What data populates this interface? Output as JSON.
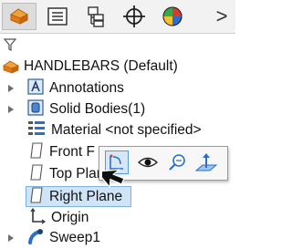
{
  "colors": {
    "accent_blue": "#3a7fc4",
    "selection_bg": "#cfe5f7",
    "orange": "#e07b1a"
  },
  "tabs": [
    {
      "icon": "feature-manager-icon",
      "active": true
    },
    {
      "icon": "property-manager-icon",
      "active": false
    },
    {
      "icon": "configuration-manager-icon",
      "active": false
    },
    {
      "icon": "dimxpert-manager-icon",
      "active": false
    },
    {
      "icon": "display-manager-icon",
      "active": false
    }
  ],
  "tab_more": ">",
  "tree": {
    "root": "HANDLEBARS (Default)",
    "items": [
      {
        "label": "Annotations",
        "icon": "annotations-icon",
        "expandable": true
      },
      {
        "label": "Solid Bodies(1)",
        "icon": "solid-bodies-icon",
        "expandable": true
      },
      {
        "label": "Material <not specified>",
        "icon": "material-icon",
        "expandable": false
      },
      {
        "label": "Front Plane",
        "visible_text": "Front F",
        "icon": "plane-icon",
        "expandable": false
      },
      {
        "label": "Top Plane",
        "icon": "plane-icon",
        "expandable": false
      },
      {
        "label": "Right Plane",
        "icon": "plane-icon",
        "expandable": false,
        "selected": true
      },
      {
        "label": "Origin",
        "icon": "origin-icon",
        "expandable": false
      },
      {
        "label": "Sweep1",
        "icon": "sweep-icon",
        "expandable": true
      }
    ]
  },
  "context_toolbar": {
    "buttons": [
      {
        "name": "sketch-icon",
        "active": true
      },
      {
        "name": "show-hide-icon",
        "active": false
      },
      {
        "name": "zoom-to-selection-icon",
        "active": false
      },
      {
        "name": "normal-to-icon",
        "active": false
      }
    ]
  }
}
